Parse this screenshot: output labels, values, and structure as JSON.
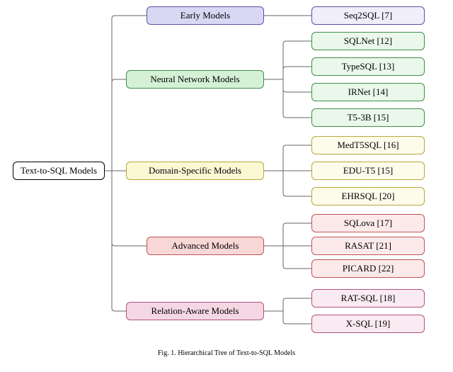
{
  "chart_data": {
    "type": "tree",
    "title": "Hierarchical Tree of Text-to-SQL Models",
    "root": "Text-to-SQL Models",
    "categories": [
      {
        "name": "Early Models",
        "color": "purple",
        "items": [
          "Seq2SQL [7]"
        ]
      },
      {
        "name": "Neural Network Models",
        "color": "green",
        "items": [
          "SQLNet [12]",
          "TypeSQL [13]",
          "IRNet [14]",
          "T5-3B [15]"
        ]
      },
      {
        "name": "Domain-Specific Models",
        "color": "yellow",
        "items": [
          "MedT5SQL [16]",
          "EDU-T5 [15]",
          "EHRSQL [20]"
        ]
      },
      {
        "name": "Advanced Models",
        "color": "red",
        "items": [
          "SQLova [17]",
          "RASAT [21]",
          "PICARD [22]"
        ]
      },
      {
        "name": "Relation-Aware Models",
        "color": "pink",
        "items": [
          "RAT-SQL [18]",
          "X-SQL [19]"
        ]
      }
    ]
  },
  "root_label": "Text-to-SQL Models",
  "caption": "Fig. 1.   Hierarchical Tree of Text-to-SQL Models",
  "categories": {
    "early": {
      "label": "Early Models"
    },
    "neural": {
      "label": "Neural Network Models"
    },
    "domain": {
      "label": "Domain-Specific Models"
    },
    "advanced": {
      "label": "Advanced Models"
    },
    "relation": {
      "label": "Relation-Aware Models"
    }
  },
  "leaves": {
    "seq2sql": "Seq2SQL [7]",
    "sqlnet": "SQLNet [12]",
    "typesql": "TypeSQL [13]",
    "irnet": "IRNet [14]",
    "t53b": "T5-3B [15]",
    "medt5sql": "MedT5SQL [16]",
    "edut5": "EDU-T5 [15]",
    "ehrsql": "EHRSQL [20]",
    "sqlova": "SQLova [17]",
    "rasat": "RASAT [21]",
    "picard": "PICARD [22]",
    "ratsql": "RAT-SQL [18]",
    "xsql": "X-SQL [19]"
  }
}
